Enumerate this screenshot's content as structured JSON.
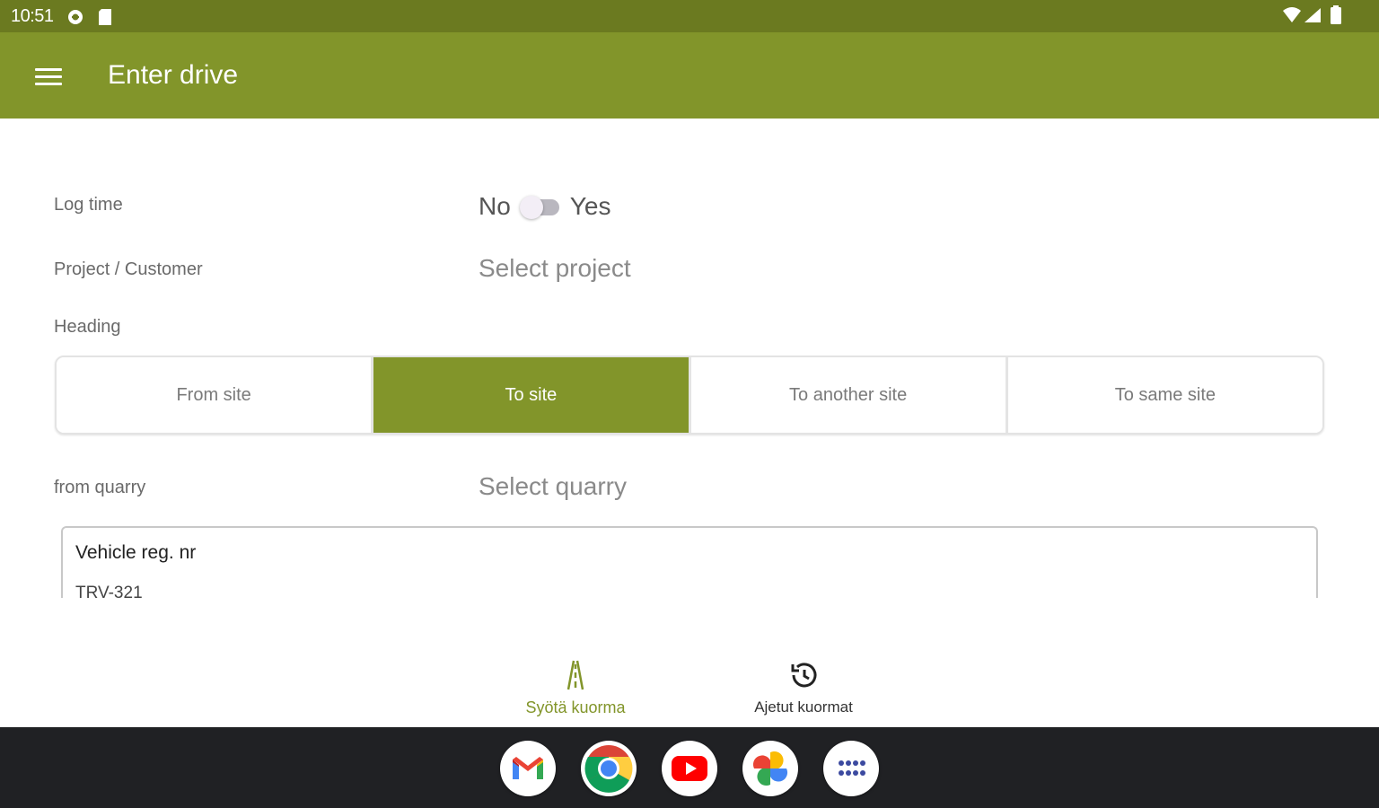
{
  "status_bar": {
    "time": "10:51",
    "icons": [
      "settings-status-icon",
      "sd-card-icon",
      "wifi-icon",
      "signal-icon",
      "battery-icon"
    ]
  },
  "app_bar": {
    "title": "Enter drive",
    "color": "#82952a",
    "menu_icon": "hamburger-menu-icon"
  },
  "form": {
    "log_time": {
      "label": "Log time",
      "off_label": "No",
      "on_label": "Yes",
      "value": false
    },
    "project": {
      "label": "Project / Customer",
      "placeholder": "Select project"
    },
    "heading": {
      "label": "Heading",
      "options": [
        "From site",
        "To site",
        "To another site",
        "To same site"
      ],
      "selected": "To site"
    },
    "quarry": {
      "label": "from quarry",
      "placeholder": "Select quarry"
    },
    "vehicle": {
      "label": "Vehicle reg. nr",
      "value": "TRV-321"
    }
  },
  "bottom_nav": {
    "items": [
      {
        "label": "Syötä kuorma",
        "icon": "road-icon",
        "active": true
      },
      {
        "label": "Ajetut kuormat",
        "icon": "history-icon",
        "active": false
      }
    ],
    "active_color": "#82952a"
  },
  "dock": {
    "apps": [
      "gmail-icon",
      "chrome-icon",
      "youtube-icon",
      "photos-icon",
      "app-drawer-icon"
    ]
  }
}
